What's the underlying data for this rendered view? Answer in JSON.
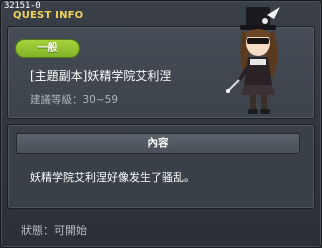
{
  "window": {
    "quest_id": "32151-0",
    "title": "QUEST INFO"
  },
  "quest": {
    "category_badge": "一般",
    "name": "[主題副本]妖精学院艾利涅",
    "level_range": "建議等級：30~59",
    "npc_icon": "npc-portrait-icon"
  },
  "content": {
    "header": "內容",
    "description": "妖精学院艾利涅好像发生了骚乱。"
  },
  "status": {
    "text": "狀態：可開始"
  },
  "colors": {
    "title": "#f2d25a",
    "badge": "#8fc22e",
    "background": "#30353b"
  }
}
